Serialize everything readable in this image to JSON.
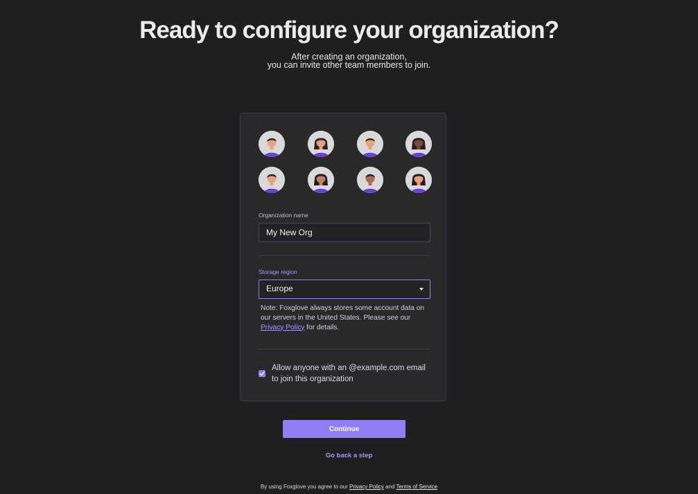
{
  "header": {
    "title": "Ready to configure your organization?",
    "subtitle_line1": "After creating an organization,",
    "subtitle_line2": "you can invite other team members to join."
  },
  "avatars": [
    {
      "name": "avatar-1",
      "skin": "#e9a37e",
      "hair": "#2b2230"
    },
    {
      "name": "avatar-2",
      "skin": "#e7a07b",
      "hair": "#2b2230"
    },
    {
      "name": "avatar-3",
      "skin": "#e9a37e",
      "hair": "#3a2a2a"
    },
    {
      "name": "avatar-4",
      "skin": "#7b4a36",
      "hair": "#231c22"
    },
    {
      "name": "avatar-5",
      "skin": "#e9a37e",
      "hair": "#2b2230"
    },
    {
      "name": "avatar-6",
      "skin": "#c77e60",
      "hair": "#231c22"
    },
    {
      "name": "avatar-7",
      "skin": "#b06c52",
      "hair": "#2b2230"
    },
    {
      "name": "avatar-8",
      "skin": "#e7a07b",
      "hair": "#231c22"
    }
  ],
  "form": {
    "org_label": "Organization name",
    "org_value": "My New Org",
    "region_label": "Storage region",
    "region_value": "Europe",
    "note_prefix": "Note: Foxglove always stores some account data on our servers in the United States. Please see our",
    "note_link": "Privacy Policy",
    "note_suffix": "for details.",
    "allow_label": "Allow anyone with an @example.com email to join this organization",
    "allow_checked": true
  },
  "actions": {
    "continue": "Continue",
    "back": "Go back a step"
  },
  "footer": {
    "prefix": "By using Foxglove you agree to our",
    "privacy": "Privacy Policy",
    "and": "and",
    "terms": "Terms of Service"
  },
  "colors": {
    "background": "#1f1f21",
    "card": "#29292c",
    "accent": "#8f7ef5",
    "link": "#a796ff",
    "avatar_shirt": "#6a3fd6"
  }
}
